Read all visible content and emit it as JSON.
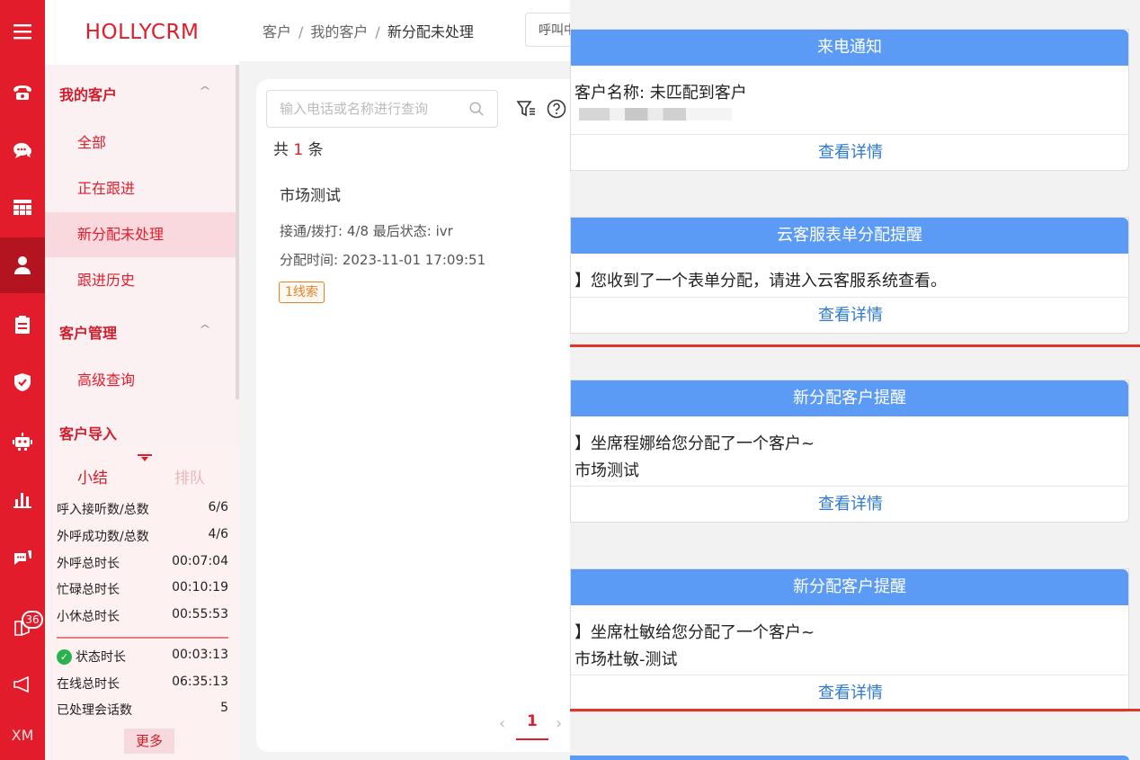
{
  "rail": {
    "items": [
      {
        "icon": "menu-icon"
      },
      {
        "icon": "phone-icon"
      },
      {
        "icon": "chat-icon"
      },
      {
        "icon": "grid-icon"
      },
      {
        "icon": "user-icon"
      },
      {
        "icon": "clipboard-icon"
      },
      {
        "icon": "shield-icon"
      },
      {
        "icon": "robot-icon"
      },
      {
        "icon": "bar-chart-icon"
      },
      {
        "icon": "message-icon"
      },
      {
        "icon": "book-icon"
      },
      {
        "icon": "megaphone-icon"
      }
    ],
    "badge": "36",
    "user_initials": "XM"
  },
  "sidebar": {
    "brand": "HOLLYCRM",
    "group_my_customers": "我的客户",
    "nav_all": "全部",
    "nav_following": "正在跟进",
    "nav_new_unprocessed": "新分配未处理",
    "nav_history": "跟进历史",
    "group_customer_mgmt": "客户管理",
    "nav_advanced_query": "高级查询",
    "group_customer_import": "客户导入",
    "caret": "^"
  },
  "stats": {
    "tab_summary": "小结",
    "tab_queue": "排队",
    "rows": [
      {
        "label": "呼入接听数/总数",
        "value": "6/6"
      },
      {
        "label": "外呼成功数/总数",
        "value": "4/6"
      },
      {
        "label": "外呼总时长",
        "value": "00:07:04"
      },
      {
        "label": "忙碌总时长",
        "value": "00:10:19"
      },
      {
        "label": "小休总时长",
        "value": "00:55:53"
      },
      {
        "label": "状态时长",
        "value": "00:03:13"
      },
      {
        "label": "在线总时长",
        "value": "06:35:13"
      },
      {
        "label": "已处理会话数",
        "value": "5"
      }
    ],
    "more": "更多"
  },
  "header": {
    "crumb_1": "客户",
    "crumb_2": "我的客户",
    "crumb_3": "新分配未处理",
    "sep": "/",
    "call_label": "呼叫中"
  },
  "list": {
    "search_placeholder": "输入电话或名称进行查询",
    "total_prefix": "共",
    "total_count": "1",
    "total_suffix": "条",
    "item": {
      "title": "市场测试",
      "line1": "接通/拨打:  4/8    最后状态:  ivr",
      "line2": "分配时间:  2023-11-01 17:09:51",
      "tag": "1线索"
    },
    "page": "1",
    "prev": "‹",
    "next": "›"
  },
  "notifications": [
    {
      "title": "来电通知",
      "lines": [
        "客户名称: 未匹配到客户"
      ],
      "detail": "查看详情"
    },
    {
      "title": "云客服表单分配提醒",
      "lines": [
        "】您收到了一个表单分配，请进入云客服系统查看。"
      ],
      "detail": "查看详情"
    },
    {
      "title": "新分配客户提醒",
      "lines": [
        "】坐席程娜给您分配了一个客户~",
        "市场测试"
      ],
      "detail": "查看详情"
    },
    {
      "title": "新分配客户提醒",
      "lines": [
        "】坐席杜敏给您分配了一个客户~",
        "市场杜敏-测试"
      ],
      "detail": "查看详情"
    }
  ]
}
